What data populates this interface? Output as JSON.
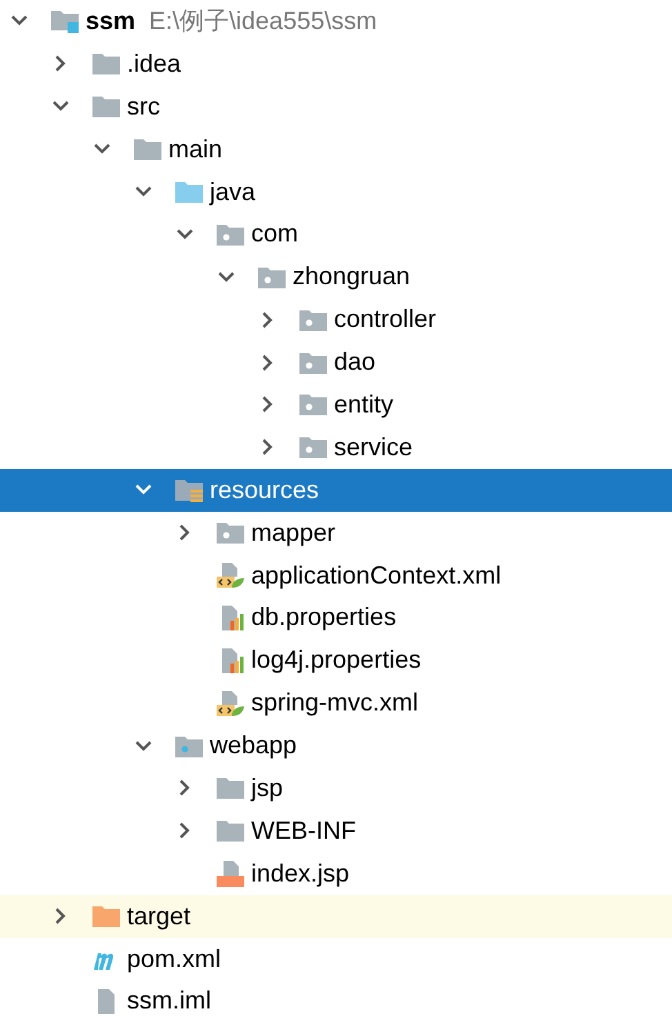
{
  "tree": [
    {
      "label": "ssm",
      "path": "E:\\例子\\idea555\\ssm",
      "kind": "module",
      "expanded": true,
      "selected": false,
      "highlighted": false,
      "children": [
        {
          "label": ".idea",
          "kind": "folder",
          "expanded": false,
          "selected": false,
          "highlighted": false
        },
        {
          "label": "src",
          "kind": "folder",
          "expanded": true,
          "selected": false,
          "highlighted": false,
          "children": [
            {
              "label": "main",
              "kind": "folder",
              "expanded": true,
              "selected": false,
              "highlighted": false,
              "children": [
                {
                  "label": "java",
                  "kind": "source-folder",
                  "expanded": true,
                  "selected": false,
                  "highlighted": false,
                  "children": [
                    {
                      "label": "com",
                      "kind": "package",
                      "expanded": true,
                      "selected": false,
                      "highlighted": false,
                      "children": [
                        {
                          "label": "zhongruan",
                          "kind": "package",
                          "expanded": true,
                          "selected": false,
                          "highlighted": false,
                          "children": [
                            {
                              "label": "controller",
                              "kind": "package",
                              "expanded": false,
                              "selected": false,
                              "highlighted": false
                            },
                            {
                              "label": "dao",
                              "kind": "package",
                              "expanded": false,
                              "selected": false,
                              "highlighted": false
                            },
                            {
                              "label": "entity",
                              "kind": "package",
                              "expanded": false,
                              "selected": false,
                              "highlighted": false
                            },
                            {
                              "label": "service",
                              "kind": "package",
                              "expanded": false,
                              "selected": false,
                              "highlighted": false
                            }
                          ]
                        }
                      ]
                    }
                  ]
                },
                {
                  "label": "resources",
                  "kind": "resources-folder",
                  "expanded": true,
                  "selected": true,
                  "highlighted": false,
                  "children": [
                    {
                      "label": "mapper",
                      "kind": "package",
                      "expanded": false,
                      "selected": false,
                      "highlighted": false
                    },
                    {
                      "label": "applicationContext.xml",
                      "kind": "spring-xml",
                      "selected": false,
                      "highlighted": false
                    },
                    {
                      "label": "db.properties",
                      "kind": "properties",
                      "selected": false,
                      "highlighted": false
                    },
                    {
                      "label": "log4j.properties",
                      "kind": "properties",
                      "selected": false,
                      "highlighted": false
                    },
                    {
                      "label": "spring-mvc.xml",
                      "kind": "spring-xml",
                      "selected": false,
                      "highlighted": false
                    }
                  ]
                },
                {
                  "label": "webapp",
                  "kind": "web-folder",
                  "expanded": true,
                  "selected": false,
                  "highlighted": false,
                  "children": [
                    {
                      "label": "jsp",
                      "kind": "folder",
                      "expanded": false,
                      "selected": false,
                      "highlighted": false
                    },
                    {
                      "label": "WEB-INF",
                      "kind": "folder",
                      "expanded": false,
                      "selected": false,
                      "highlighted": false
                    },
                    {
                      "label": "index.jsp",
                      "kind": "jsp",
                      "selected": false,
                      "highlighted": false
                    }
                  ]
                }
              ]
            }
          ]
        },
        {
          "label": "target",
          "kind": "excluded-folder",
          "expanded": false,
          "selected": false,
          "highlighted": true
        },
        {
          "label": "pom.xml",
          "kind": "maven",
          "selected": false,
          "highlighted": false
        },
        {
          "label": "ssm.iml",
          "kind": "iml",
          "selected": false,
          "highlighted": false
        }
      ]
    }
  ]
}
